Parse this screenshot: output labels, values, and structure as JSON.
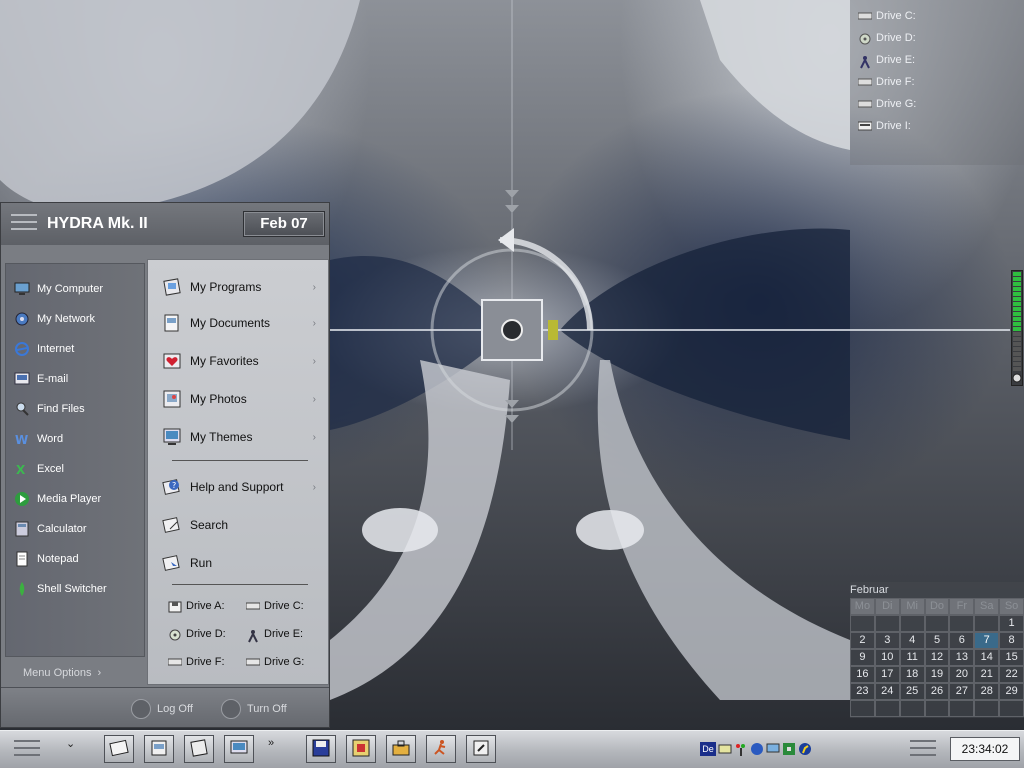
{
  "start_menu": {
    "title": "HYDRA Mk. II",
    "date": "Feb 07",
    "left_items": [
      {
        "label": "My Computer",
        "icon": "computer-icon"
      },
      {
        "label": "My Network",
        "icon": "network-icon"
      },
      {
        "label": "Internet",
        "icon": "internet-icon"
      },
      {
        "label": "E-mail",
        "icon": "email-icon"
      },
      {
        "label": "Find Files",
        "icon": "find-files-icon"
      },
      {
        "label": "Word",
        "icon": "word-icon"
      },
      {
        "label": "Excel",
        "icon": "excel-icon"
      },
      {
        "label": "Media Player",
        "icon": "media-player-icon"
      },
      {
        "label": "Calculator",
        "icon": "calculator-icon"
      },
      {
        "label": "Notepad",
        "icon": "notepad-icon"
      },
      {
        "label": "Shell Switcher",
        "icon": "shell-switcher-icon"
      }
    ],
    "right_items": [
      {
        "label": "My Programs",
        "icon": "programs-icon"
      },
      {
        "label": "My Documents",
        "icon": "documents-icon"
      },
      {
        "label": "My Favorites",
        "icon": "favorites-icon"
      },
      {
        "label": "My Photos",
        "icon": "photos-icon"
      },
      {
        "label": "My Themes",
        "icon": "themes-icon"
      },
      {
        "label": "Help and Support",
        "icon": "help-icon"
      },
      {
        "label": "Search",
        "icon": "search-icon"
      },
      {
        "label": "Run",
        "icon": "run-icon"
      }
    ],
    "drives": [
      {
        "label": "Drive A:",
        "icon": "floppy-drive-icon"
      },
      {
        "label": "Drive C:",
        "icon": "hard-drive-icon"
      },
      {
        "label": "Drive D:",
        "icon": "cd-drive-icon"
      },
      {
        "label": "Drive E:",
        "icon": "network-drive-icon"
      },
      {
        "label": "Drive F:",
        "icon": "hard-drive-icon"
      },
      {
        "label": "Drive G:",
        "icon": "hard-drive-icon"
      }
    ],
    "menu_options": "Menu Options",
    "log_off": "Log Off",
    "turn_off": "Turn Off"
  },
  "desktop_drives": [
    {
      "label": "Drive C:",
      "icon": "hard-drive-icon"
    },
    {
      "label": "Drive D:",
      "icon": "cd-drive-icon"
    },
    {
      "label": "Drive E:",
      "icon": "network-drive-icon"
    },
    {
      "label": "Drive F:",
      "icon": "hard-drive-icon"
    },
    {
      "label": "Drive G:",
      "icon": "hard-drive-icon"
    },
    {
      "label": "Drive I:",
      "icon": "removable-drive-icon"
    }
  ],
  "calendar": {
    "month": "Februar",
    "weekdays": [
      "Mo",
      "Di",
      "Mi",
      "Do",
      "Fr",
      "Sa",
      "So"
    ],
    "weeks": [
      [
        "",
        "",
        "",
        "",
        "",
        "",
        "1"
      ],
      [
        "2",
        "3",
        "4",
        "5",
        "6",
        "7",
        "8"
      ],
      [
        "9",
        "10",
        "11",
        "12",
        "13",
        "14",
        "15"
      ],
      [
        "16",
        "17",
        "18",
        "19",
        "20",
        "21",
        "22"
      ],
      [
        "23",
        "24",
        "25",
        "26",
        "27",
        "28",
        "29"
      ],
      [
        "",
        "",
        "",
        "",
        "",
        "",
        ""
      ]
    ],
    "today": "7"
  },
  "volume_level": 0.6,
  "taskbar": {
    "chevron_1": "»",
    "chevron_down": "⌄",
    "clock": "23:34:02",
    "tray_language": "De",
    "quick_launch": [
      "explorer-icon",
      "documents-icon",
      "programs-icon",
      "themes-icon"
    ],
    "running": [
      "save-icon",
      "control-panel-icon",
      "toolbox-icon",
      "run-icon",
      "help-icon"
    ],
    "tray_icons": [
      "language-icon",
      "mail-icon",
      "traffic-light-icon",
      "network-icon",
      "monitor-icon",
      "puzzle-icon",
      "runner-icon"
    ]
  }
}
